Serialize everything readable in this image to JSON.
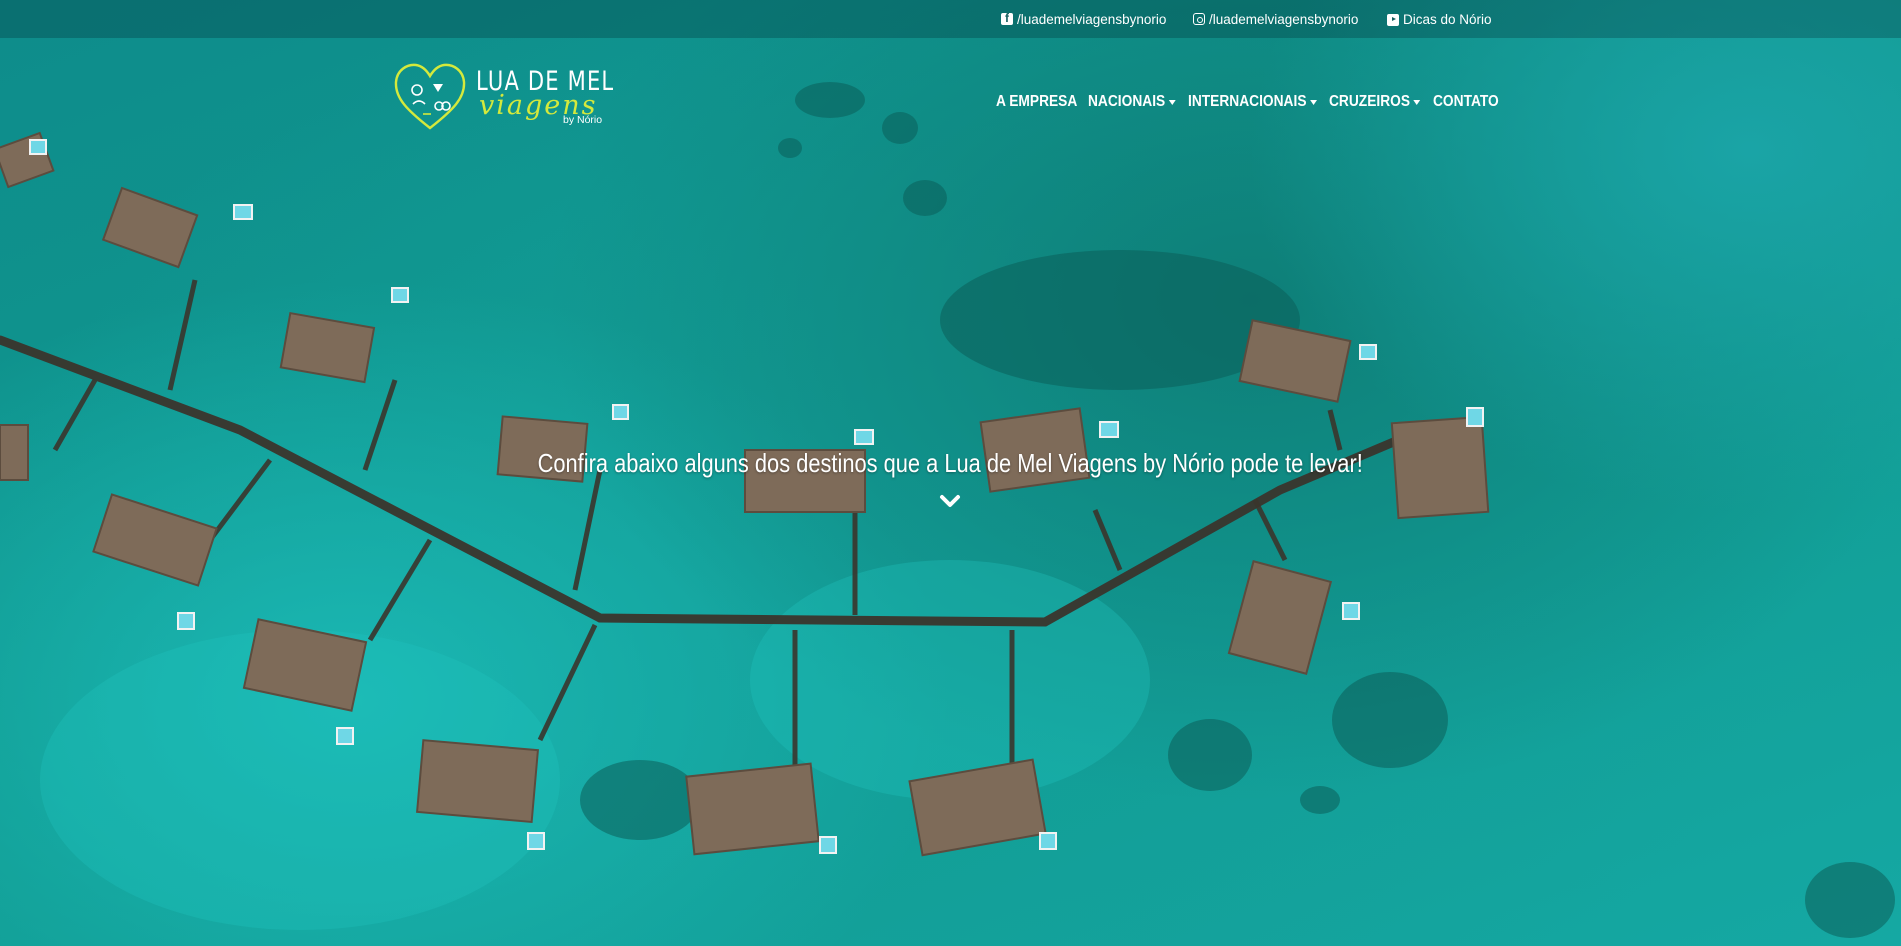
{
  "topbar": {
    "facebook": {
      "icon": "facebook-square-icon",
      "label": "/luademelviagensbynorio"
    },
    "instagram": {
      "icon": "instagram-icon",
      "label": "/luademelviagensbynorio"
    },
    "youtube": {
      "icon": "youtube-icon",
      "label": "Dicas do Nório"
    }
  },
  "logo": {
    "title": "LUA DE MEL",
    "script": "viagens",
    "byline": "by Nório"
  },
  "nav": {
    "items": [
      {
        "label": "A EMPRESA",
        "dropdown": false
      },
      {
        "label": "NACIONAIS",
        "dropdown": true
      },
      {
        "label": "INTERNACIONAIS",
        "dropdown": true
      },
      {
        "label": "CRUZEIROS",
        "dropdown": true
      },
      {
        "label": "CONTATO",
        "dropdown": false
      }
    ]
  },
  "hero": {
    "headline": "Confira abaixo alguns dos destinos que a Lua de Mel Viagens by Nório pode te levar!",
    "scroll_icon": "chevron-down-icon"
  },
  "colors": {
    "accent": "#d4e93c",
    "water": "#10998f",
    "text": "#ffffff"
  }
}
